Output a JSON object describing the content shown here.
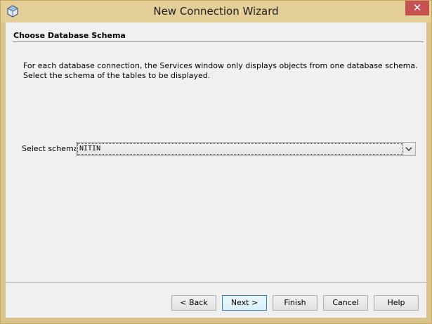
{
  "window": {
    "title": "New Connection Wizard",
    "close_label": "✕",
    "colors": {
      "frame": "#e4cf98",
      "close": "#c75050",
      "client": "#f0f0f0"
    }
  },
  "step": {
    "title": "Choose Database Schema",
    "description_line1": "For each database connection, the Services window only displays objects from one database schema.",
    "description_line2": "Select the schema of the tables to be displayed."
  },
  "schema": {
    "label": "Select schema:",
    "selected": "NITIN"
  },
  "buttons": {
    "back": "< Back",
    "next": "Next >",
    "finish": "Finish",
    "cancel": "Cancel",
    "help": "Help"
  },
  "icons": {
    "app": "netbeans-cube-icon",
    "dropdown": "chevron-down-icon",
    "close": "close-icon"
  }
}
